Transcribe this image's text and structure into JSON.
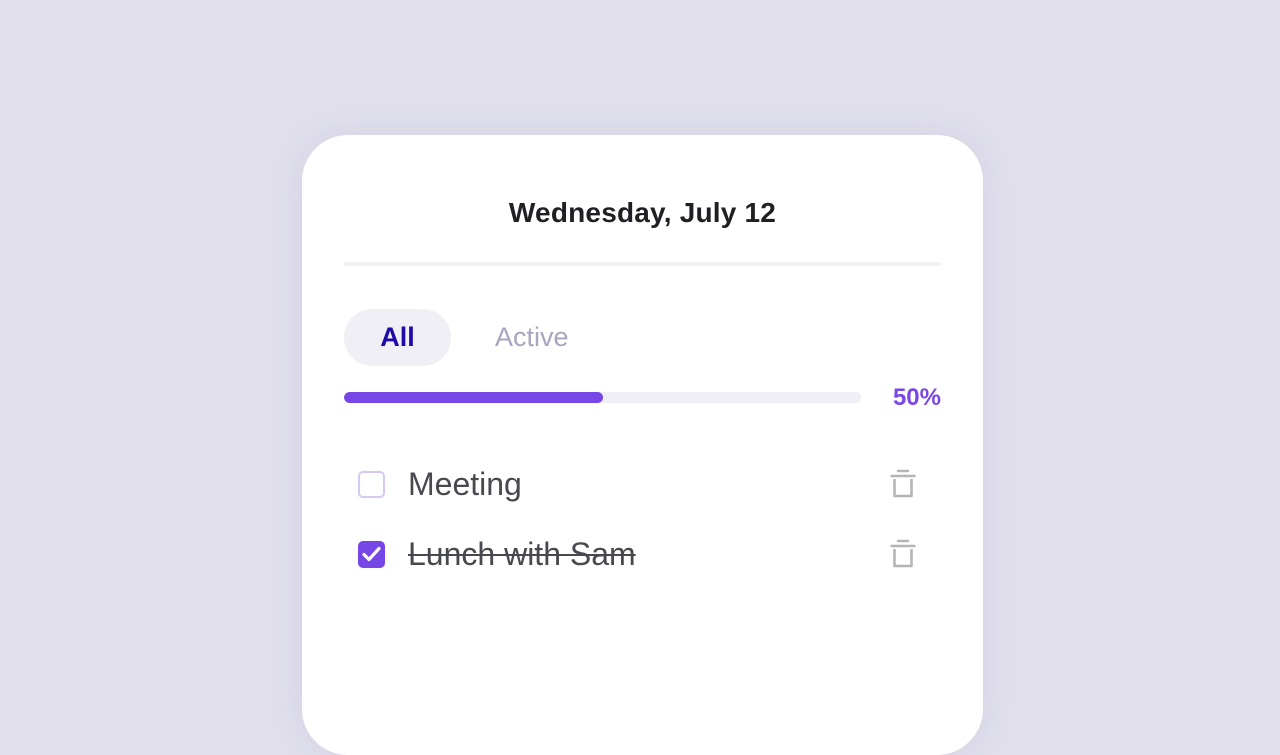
{
  "header": {
    "date": "Wednesday, July 12"
  },
  "filters": {
    "tabs": [
      {
        "label": "All",
        "selected": true
      },
      {
        "label": "Active",
        "selected": false
      }
    ]
  },
  "progress": {
    "value": 0.5,
    "label": "50%"
  },
  "tasks": [
    {
      "text": "Meeting",
      "completed": false
    },
    {
      "text": "Lunch with Sam",
      "completed": true
    }
  ],
  "icons": {
    "check": "check-icon",
    "delete": "trash-icon"
  },
  "colors": {
    "accent": "#7646e6",
    "selected_tab_text": "#1e0aa8",
    "inactive_tab_text": "#a7a5c0",
    "background": "#e0dfeb"
  }
}
